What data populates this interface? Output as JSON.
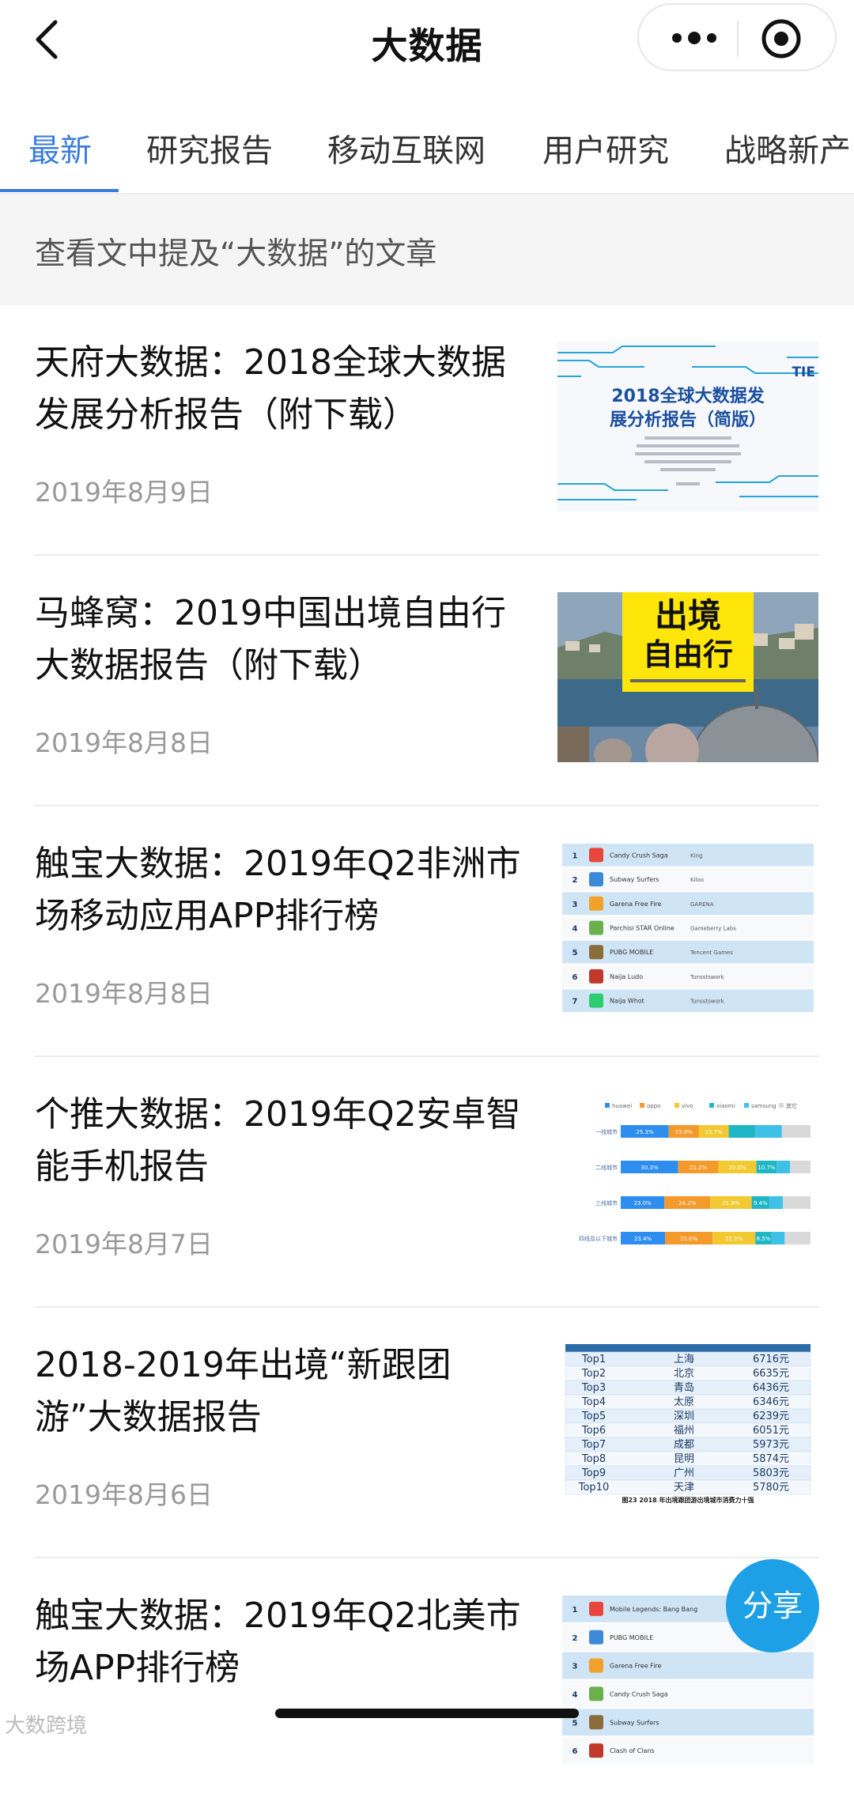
{
  "nav": {
    "title": "大数据"
  },
  "tabs": [
    {
      "label": "最新",
      "active": true
    },
    {
      "label": "研究报告"
    },
    {
      "label": "移动互联网"
    },
    {
      "label": "用户研究"
    },
    {
      "label": "战略新产"
    }
  ],
  "notice": "查看文中提及“大数据”的文章",
  "articles": [
    {
      "title": "天府大数据：2018全球大数据发展分析报告（附下载）",
      "date": "2019年8月9日",
      "thumb": {
        "headline_line1": "2018全球大数据发",
        "headline_line2": "展分析报告（简版）",
        "brand": "TIE"
      }
    },
    {
      "title": "马蜂窝：2019中国出境自由行大数据报告（附下载）",
      "date": "2019年8月8日",
      "thumb": {
        "line1": "出境",
        "line2": "自由行"
      }
    },
    {
      "title": "触宝大数据：2019年Q2非洲市场移动应用APP排行榜",
      "date": "2019年8月8日",
      "thumb": {
        "rows": [
          {
            "rank": "1",
            "name": "Candy Crush Saga",
            "dev": "King"
          },
          {
            "rank": "2",
            "name": "Subway Surfers",
            "dev": "Kiloo"
          },
          {
            "rank": "3",
            "name": "Garena Free Fire",
            "dev": "GARENA"
          },
          {
            "rank": "4",
            "name": "Parchisi STAR Online",
            "dev": "Gameberry Labs"
          },
          {
            "rank": "5",
            "name": "PUBG MOBILE",
            "dev": "Tencent Games"
          },
          {
            "rank": "6",
            "name": "Naija Ludo",
            "dev": "Tunsstswork"
          },
          {
            "rank": "7",
            "name": "Naija Whot",
            "dev": "Tunsstswork"
          }
        ]
      }
    },
    {
      "title": "个推大数据：2019年Q2安卓智能手机报告",
      "date": "2019年8月7日",
      "thumb": {
        "legend": [
          "huawei",
          "oppo",
          "vivo",
          "xiaomi",
          "samsung",
          "其它"
        ],
        "colors": [
          "#2e8ef0",
          "#f39a2a",
          "#f2c930",
          "#1fb6c6",
          "#3ec1e6",
          "#d9d9d9"
        ],
        "rows": [
          {
            "label": "一线城市",
            "values": [
              25.3,
              15.9,
              15.7,
              14,
              14,
              15.1
            ]
          },
          {
            "label": "二线城市",
            "values": [
              30.3,
              21.2,
              20.0,
              10.7,
              7,
              10.8
            ]
          },
          {
            "label": "三线城市",
            "values": [
              23.0,
              24.2,
              21.8,
              9.4,
              7,
              14.6
            ]
          },
          {
            "label": "四线及以下城市",
            "values": [
              23.4,
              25.0,
              22.5,
              8.5,
              7,
              13.6
            ]
          }
        ],
        "value_labels": [
          [
            "25.3%",
            "15.9%",
            "15.7%"
          ],
          [
            "30.3%",
            "21.2%",
            "20.0%",
            "10.7%"
          ],
          [
            "23.0%",
            "24.2%",
            "21.8%",
            "9.4%"
          ],
          [
            "23.4%",
            "25.0%",
            "22.5%",
            "8.5%"
          ]
        ]
      }
    },
    {
      "title": "2018-2019年出境“新跟团游”大数据报告",
      "date": "2019年8月6日",
      "thumb": {
        "rows": [
          {
            "rank": "Top1",
            "city": "上海",
            "value": "6716元"
          },
          {
            "rank": "Top2",
            "city": "北京",
            "value": "6635元"
          },
          {
            "rank": "Top3",
            "city": "青岛",
            "value": "6436元"
          },
          {
            "rank": "Top4",
            "city": "太原",
            "value": "6346元"
          },
          {
            "rank": "Top5",
            "city": "深圳",
            "value": "6239元"
          },
          {
            "rank": "Top6",
            "city": "福州",
            "value": "6051元"
          },
          {
            "rank": "Top7",
            "city": "成都",
            "value": "5973元"
          },
          {
            "rank": "Top8",
            "city": "昆明",
            "value": "5874元"
          },
          {
            "rank": "Top9",
            "city": "广州",
            "value": "5803元"
          },
          {
            "rank": "Top10",
            "city": "天津",
            "value": "5780元"
          }
        ],
        "caption": "图23 2018 年出境跟团游出境城市消费力十强"
      }
    },
    {
      "title": "触宝大数据：2019年Q2北美市场APP排行榜",
      "date": "",
      "thumb": {
        "rows": [
          {
            "rank": "1",
            "name": "Mobile Legends: Bang Bang"
          },
          {
            "rank": "2",
            "name": "PUBG MOBILE"
          },
          {
            "rank": "3",
            "name": "Garena Free Fire"
          },
          {
            "rank": "4",
            "name": "Candy Crush Saga"
          },
          {
            "rank": "5",
            "name": "Subway Surfers"
          },
          {
            "rank": "6",
            "name": "Clash of Clans"
          }
        ]
      }
    }
  ],
  "share_label": "分享",
  "watermark": "大数跨境"
}
